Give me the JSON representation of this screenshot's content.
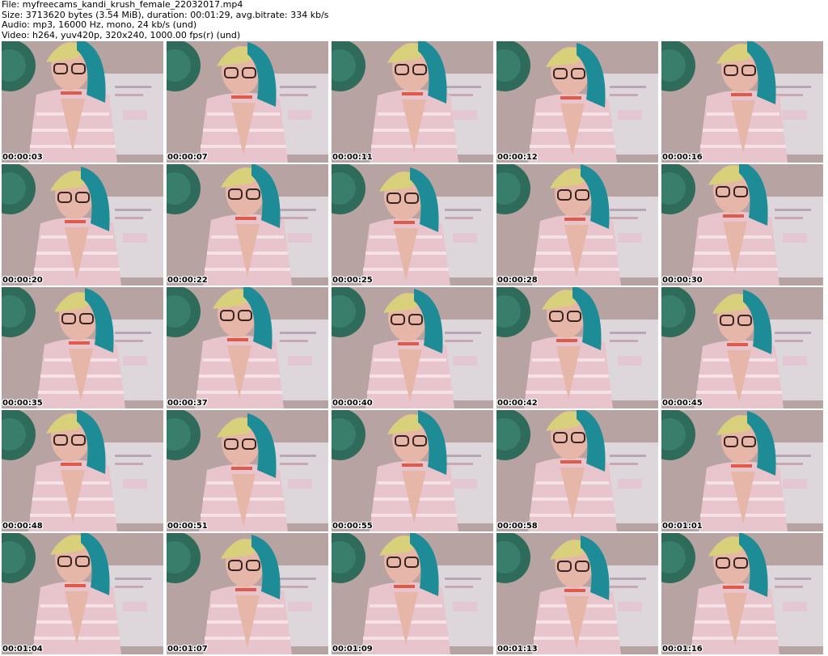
{
  "header": {
    "file_line": "File: myfreecams_kandi_krush_female_22032017.mp4",
    "size_line": "Size: 3713620 bytes (3.54 MiB), duration: 00:01:29, avg.bitrate: 334 kb/s",
    "audio_line": "Audio: mp3, 16000 Hz, mono, 24 kb/s (und)",
    "video_line": "Video: h264, yuv420p, 320x240, 1000.00 fps(r) (und)"
  },
  "thumbnails": [
    {
      "time": "00:00:03"
    },
    {
      "time": "00:00:07"
    },
    {
      "time": "00:00:11"
    },
    {
      "time": "00:00:12"
    },
    {
      "time": "00:00:16"
    },
    {
      "time": "00:00:20"
    },
    {
      "time": "00:00:22"
    },
    {
      "time": "00:00:25"
    },
    {
      "time": "00:00:28"
    },
    {
      "time": "00:00:30"
    },
    {
      "time": "00:00:35"
    },
    {
      "time": "00:00:37"
    },
    {
      "time": "00:00:40"
    },
    {
      "time": "00:00:42"
    },
    {
      "time": "00:00:45"
    },
    {
      "time": "00:00:48"
    },
    {
      "time": "00:00:51"
    },
    {
      "time": "00:00:55"
    },
    {
      "time": "00:00:58"
    },
    {
      "time": "00:01:01"
    },
    {
      "time": "00:01:04"
    },
    {
      "time": "00:01:07"
    },
    {
      "time": "00:01:09"
    },
    {
      "time": "00:01:13"
    },
    {
      "time": "00:01:16"
    }
  ],
  "colors": {
    "background": "#ffffff",
    "wall": "#b7a3a2",
    "fan": "#2f6b5a",
    "hair_teal": "#1d8c96",
    "hair_blonde": "#d8d07a",
    "shirt_pink": "#e8c4cc",
    "skin": "#e6b6a8",
    "paper": "#ddd6da"
  }
}
